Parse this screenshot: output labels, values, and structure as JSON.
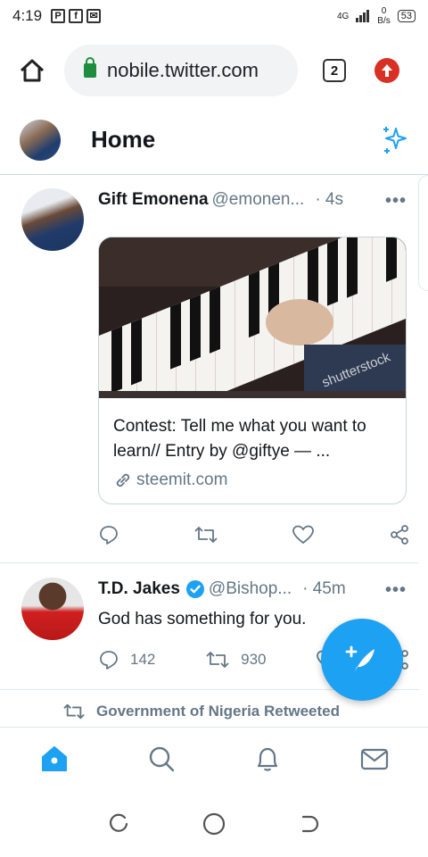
{
  "status": {
    "time": "4:19",
    "network": "4G",
    "data_rate": "0",
    "data_unit": "B/s",
    "battery": "53"
  },
  "browser": {
    "url": "nobile.twitter.com",
    "tab_count": "2"
  },
  "header": {
    "title": "Home"
  },
  "tweets": [
    {
      "name": "Gift Emonena",
      "handle": "@emonen...",
      "time": "· 4s",
      "card": {
        "title": "Contest: Tell me what you want to learn// Entry by @giftye — ...",
        "domain": "steemit.com",
        "watermark": "shutterstock"
      }
    },
    {
      "name": "T.D. Jakes",
      "handle": "@Bishop...",
      "time": "· 45m",
      "verified": true,
      "text": "God has something for you.",
      "replies": "142",
      "retweets": "930"
    }
  ],
  "retweet_notice": "Government of Nigeria Retweeted",
  "colors": {
    "accent": "#1da1f2",
    "muted": "#657786",
    "lock": "#1e8e3e",
    "update": "#d93025"
  }
}
